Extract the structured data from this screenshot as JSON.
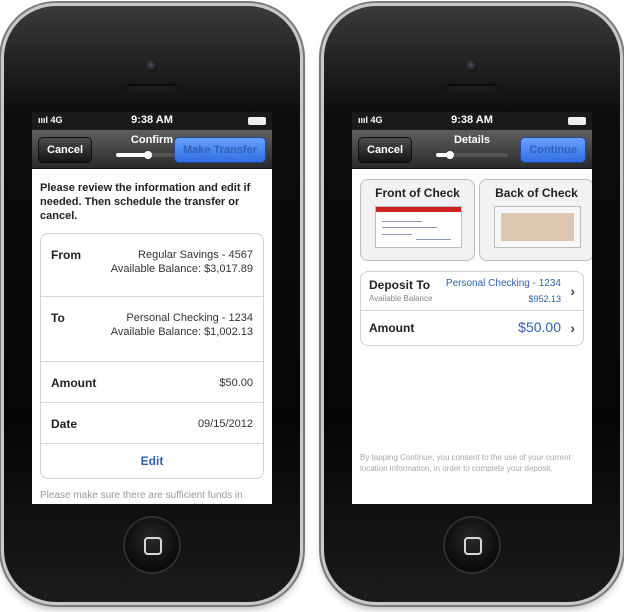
{
  "status_bar": {
    "signal": "ıııl 4G",
    "time": "9:38 AM"
  },
  "left": {
    "nav": {
      "cancel_label": "Cancel",
      "title": "Confirm",
      "action_label": "Make Transfer",
      "progress": 0.45
    },
    "intro": "Please review the information and edit if needed. Then schedule the transfer or cancel.",
    "rows": [
      {
        "label": "From",
        "line1": "Regular Savings - 4567",
        "line2": "Available Balance: $3,017.89"
      },
      {
        "label": "To",
        "line1": "Personal Checking - 1234",
        "line2": "Available Balance: $1,002.13"
      },
      {
        "label": "Amount",
        "line1": "$50.00"
      },
      {
        "label": "Date",
        "line1": "09/15/2012"
      }
    ],
    "edit_label": "Edit",
    "disclaimer": "Please make sure there are sufficient funds in your From account to avoid a possible fee. For details, refer to your account agreement and applicable fee"
  },
  "right": {
    "nav": {
      "cancel_label": "Cancel",
      "title": "Details",
      "action_label": "Continue",
      "progress": 0.2
    },
    "front_label": "Front of Check",
    "back_label": "Back of Check",
    "deposit_to_label": "Deposit To",
    "deposit_account": "Personal Checking - 1234",
    "available_label": "Available Balance",
    "available_value": "$952.13",
    "amount_label": "Amount",
    "amount_value": "$50.00",
    "footer_note": "By tapping Continue, you consent to the use of your current location information, in order to complete your deposit."
  }
}
